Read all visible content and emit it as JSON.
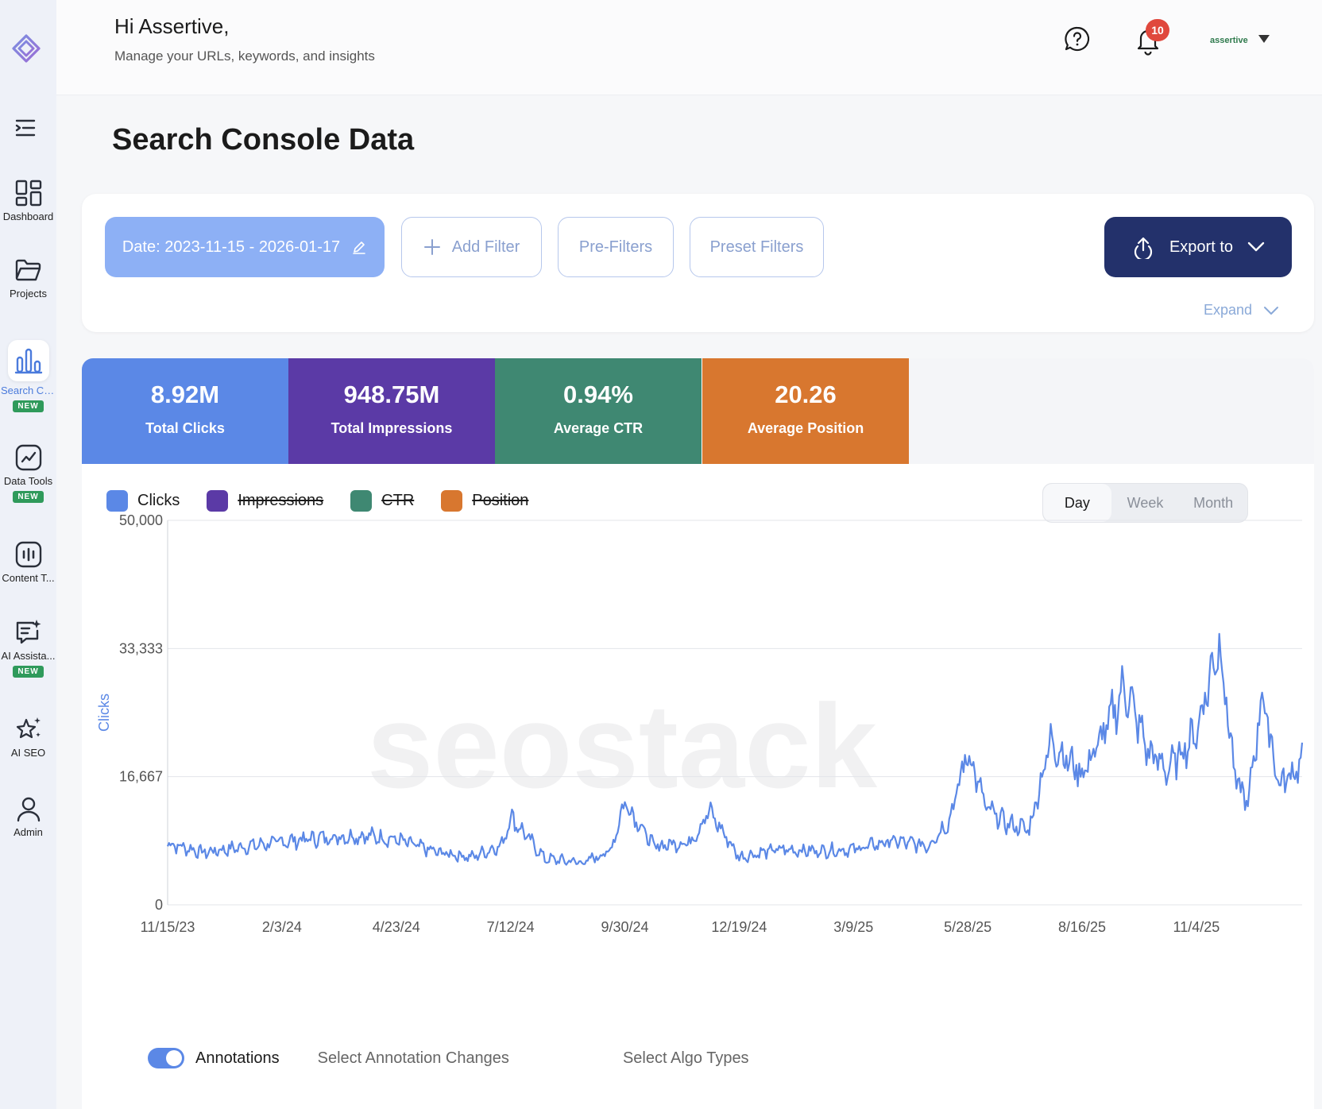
{
  "sidebar": {
    "items": [
      {
        "label": "Dashboard",
        "icon": "dashboard-icon",
        "new": false
      },
      {
        "label": "Projects",
        "icon": "folder-icon",
        "new": false
      },
      {
        "label": "Search Co...",
        "icon": "bar-chart-icon",
        "new": true,
        "active": true
      },
      {
        "label": "Data Tools",
        "icon": "line-chart-icon",
        "new": true
      },
      {
        "label": "Content T...",
        "icon": "content-icon",
        "new": false
      },
      {
        "label": "AI Assista...",
        "icon": "ai-chat-icon",
        "new": true
      },
      {
        "label": "AI SEO",
        "icon": "sparkle-star-icon",
        "new": false
      },
      {
        "label": "Admin",
        "icon": "user-icon",
        "new": false
      }
    ],
    "new_badge": "NEW"
  },
  "header": {
    "greeting": "Hi Assertive,",
    "subtitle": "Manage your URLs, keywords, and insights",
    "notification_count": "10",
    "user_name": "assertive"
  },
  "page": {
    "title": "Search Console Data"
  },
  "filters": {
    "date_label": "Date: 2023-11-15 - 2026-01-17",
    "add_filter": "Add Filter",
    "pre_filters": "Pre-Filters",
    "preset_filters": "Preset Filters",
    "export": "Export to",
    "expand": "Expand"
  },
  "stats": [
    {
      "value": "8.92M",
      "label": "Total Clicks",
      "color": "#5b88e6"
    },
    {
      "value": "948.75M",
      "label": "Total Impressions",
      "color": "#5b3aa6"
    },
    {
      "value": "0.94%",
      "label": "Average CTR",
      "color": "#3f8872"
    },
    {
      "value": "20.26",
      "label": "Average Position",
      "color": "#d8772f"
    }
  ],
  "legend": [
    {
      "label": "Clicks",
      "color": "#5b88e6",
      "enabled": true
    },
    {
      "label": "Impressions",
      "color": "#5b3aa6",
      "enabled": false
    },
    {
      "label": "CTR",
      "color": "#3f8872",
      "enabled": false
    },
    {
      "label": "Position",
      "color": "#d8772f",
      "enabled": false
    }
  ],
  "range_toggle": {
    "options": [
      "Day",
      "Week",
      "Month"
    ],
    "selected": "Day"
  },
  "annotations": {
    "label": "Annotations",
    "enabled": true,
    "select_changes": "Select Annotation Changes",
    "select_algo": "Select Algo Types"
  },
  "watermark": "seostack",
  "chart_data": {
    "type": "line",
    "ylabel": "Clicks",
    "ylim": [
      0,
      50000
    ],
    "yticks": [
      "0",
      "16,667",
      "33,333",
      "50,000"
    ],
    "x_ticks": [
      "11/15/23",
      "2/3/24",
      "4/23/24",
      "7/12/24",
      "9/30/24",
      "12/19/24",
      "3/9/25",
      "5/28/25",
      "8/16/25",
      "11/4/25"
    ],
    "grid": true,
    "series": [
      {
        "name": "Clicks",
        "color": "#5b88e6",
        "x": [
          "2023-11-15",
          "2023-12-10",
          "2024-01-10",
          "2024-02-03",
          "2024-03-01",
          "2024-04-01",
          "2024-04-23",
          "2024-05-20",
          "2024-06-15",
          "2024-07-06",
          "2024-07-12",
          "2024-08-05",
          "2024-09-01",
          "2024-09-20",
          "2024-09-30",
          "2024-10-20",
          "2024-11-15",
          "2024-11-28",
          "2024-12-19",
          "2025-01-15",
          "2025-02-10",
          "2025-03-09",
          "2025-04-05",
          "2025-04-30",
          "2025-05-15",
          "2025-05-28",
          "2025-06-10",
          "2025-06-25",
          "2025-07-10",
          "2025-07-25",
          "2025-08-05",
          "2025-08-16",
          "2025-09-01",
          "2025-09-15",
          "2025-10-01",
          "2025-10-15",
          "2025-11-04",
          "2025-11-20",
          "2025-12-01",
          "2025-12-10",
          "2025-12-20",
          "2026-01-01",
          "2026-01-17"
        ],
        "values": [
          8000,
          6800,
          7600,
          8200,
          8700,
          9000,
          8500,
          6900,
          6200,
          7800,
          11500,
          6000,
          5500,
          7000,
          13500,
          7600,
          8200,
          12200,
          6200,
          7200,
          7000,
          7200,
          8300,
          7700,
          11000,
          20000,
          12500,
          10500,
          9800,
          21500,
          19000,
          17000,
          22500,
          28500,
          20000,
          17500,
          22500,
          34500,
          16500,
          13000,
          27500,
          15500,
          18500
        ]
      }
    ]
  }
}
